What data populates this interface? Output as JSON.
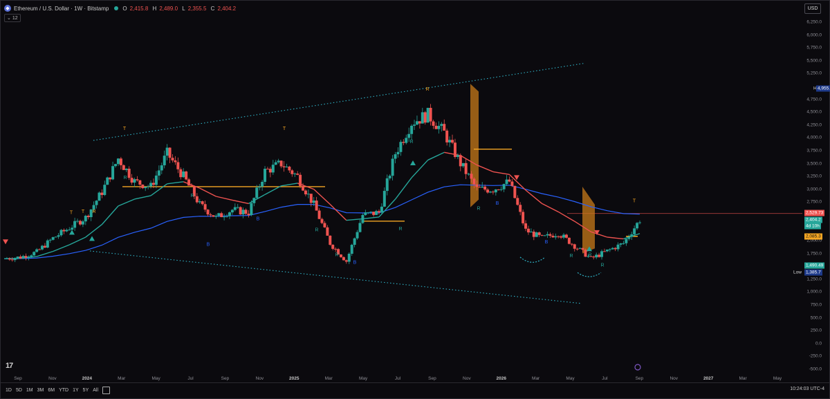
{
  "header": {
    "symbol": "Ethereum / U.S. Dollar · 1W · Bitstamp",
    "open_key": "O",
    "open": "2,415.8",
    "high_key": "H",
    "high": "2,489.0",
    "low_key": "L",
    "low": "2,355.5",
    "close_key": "C",
    "close": "2,404.2",
    "indicator_count": "12",
    "currency": "USD"
  },
  "price_axis": [
    "6,250.0",
    "6,000.0",
    "5,750.0",
    "5,500.0",
    "5,250.0",
    "4,750.0",
    "4,500.0",
    "4,250.0",
    "4,000.0",
    "3,750.0",
    "3,500.0",
    "3,250.0",
    "3,000.0",
    "2,750.0",
    "2,000.0",
    "1,750.0",
    "1,250.0",
    "1,000.0",
    "750.0",
    "500.0",
    "250.0",
    "0.0",
    "-250.0",
    "-500.0"
  ],
  "price_tags": {
    "high_key": "High",
    "high": "4,955.3",
    "resistance": "2,529.73",
    "last": "2,404.2",
    "countdown": "4d 10h",
    "level_orange": "2,085.3",
    "level_green": "1,490.49",
    "low_key": "Low",
    "low": "1,385.7"
  },
  "time_axis": [
    "Sep",
    "Nov",
    "2024",
    "Mar",
    "May",
    "Jul",
    "Sep",
    "Nov",
    "2025",
    "Mar",
    "May",
    "Jul",
    "Sep",
    "Nov",
    "2026",
    "Mar",
    "May",
    "Jul",
    "Sep",
    "Nov",
    "2027",
    "Mar",
    "May"
  ],
  "timeframes": [
    "1D",
    "5D",
    "1M",
    "3M",
    "6M",
    "YTD",
    "1Y",
    "5Y",
    "All"
  ],
  "clock": "10:24:03 UTC-4",
  "logo": "17",
  "colors": {
    "bull": "#26a69a",
    "bear": "#ef5350",
    "ema_fast": "#26a69a",
    "ema_slow": "#2962ff",
    "accent": "#f5a623"
  },
  "chart_data": {
    "type": "candlestick",
    "title": "Ethereum / U.S. Dollar · 1W · Bitstamp",
    "xlabel": "",
    "ylabel": "",
    "ylim": [
      -500,
      6250
    ],
    "x": [
      "2023-08-28",
      "2023-09-25",
      "2023-10-23",
      "2023-11-20",
      "2023-12-18",
      "2024-01-15",
      "2024-02-12",
      "2024-03-11",
      "2024-04-08",
      "2024-05-06",
      "2024-06-03",
      "2024-07-01",
      "2024-07-29",
      "2024-08-26",
      "2024-09-23",
      "2024-10-21",
      "2024-11-18",
      "2024-12-16",
      "2025-01-13",
      "2025-02-10",
      "2025-03-10",
      "2025-04-07",
      "2025-05-05",
      "2025-06-02",
      "2025-06-30",
      "2025-07-28",
      "2025-08-25",
      "2025-09-22",
      "2025-10-20",
      "2025-11-17",
      "2025-12-15",
      "2026-01-12",
      "2026-02-09",
      "2026-03-09",
      "2026-04-06",
      "2026-05-04",
      "2026-06-01",
      "2026-06-29",
      "2026-07-27",
      "2026-08-24"
    ],
    "close": [
      1650,
      1680,
      1780,
      2050,
      2250,
      2450,
      2950,
      3600,
      3150,
      3050,
      3700,
      3250,
      2700,
      2450,
      2600,
      2550,
      3350,
      3500,
      3250,
      2700,
      1950,
      1600,
      2500,
      2550,
      3700,
      4300,
      4450,
      4100,
      3500,
      3000,
      3000,
      3150,
      2200,
      2050,
      2150,
      1900,
      1650,
      1800,
      1950,
      2404
    ]
  },
  "markers": {
    "top": "T",
    "reversal": "R",
    "buy": "B"
  }
}
